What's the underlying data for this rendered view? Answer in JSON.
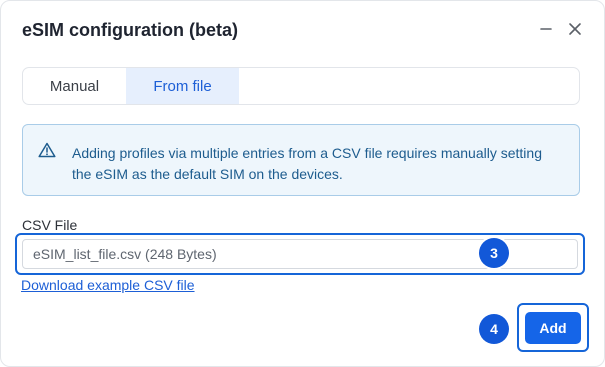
{
  "dialog": {
    "title": "eSIM configuration (beta)",
    "minimize_icon": "minus-icon",
    "close_icon": "close-icon"
  },
  "tabs": [
    {
      "label": "Manual",
      "selected": false
    },
    {
      "label": "From file",
      "selected": true
    }
  ],
  "alert": {
    "icon": "warning-triangle-icon",
    "text": "Adding profiles via multiple entries from a CSV file requires manually setting the eSIM as the default SIM on the devices."
  },
  "csv": {
    "label": "CSV File",
    "value": "eSIM_list_file.csv (248 Bytes)",
    "download_link": "Download example CSV file"
  },
  "markers": {
    "field_step": "3",
    "add_step": "4"
  },
  "actions": {
    "add_label": "Add"
  },
  "colors": {
    "accent": "#1565e8",
    "alert_bg": "#eef6fc",
    "alert_text": "#1d5c8e",
    "tab_selected_bg": "#e6effd"
  }
}
